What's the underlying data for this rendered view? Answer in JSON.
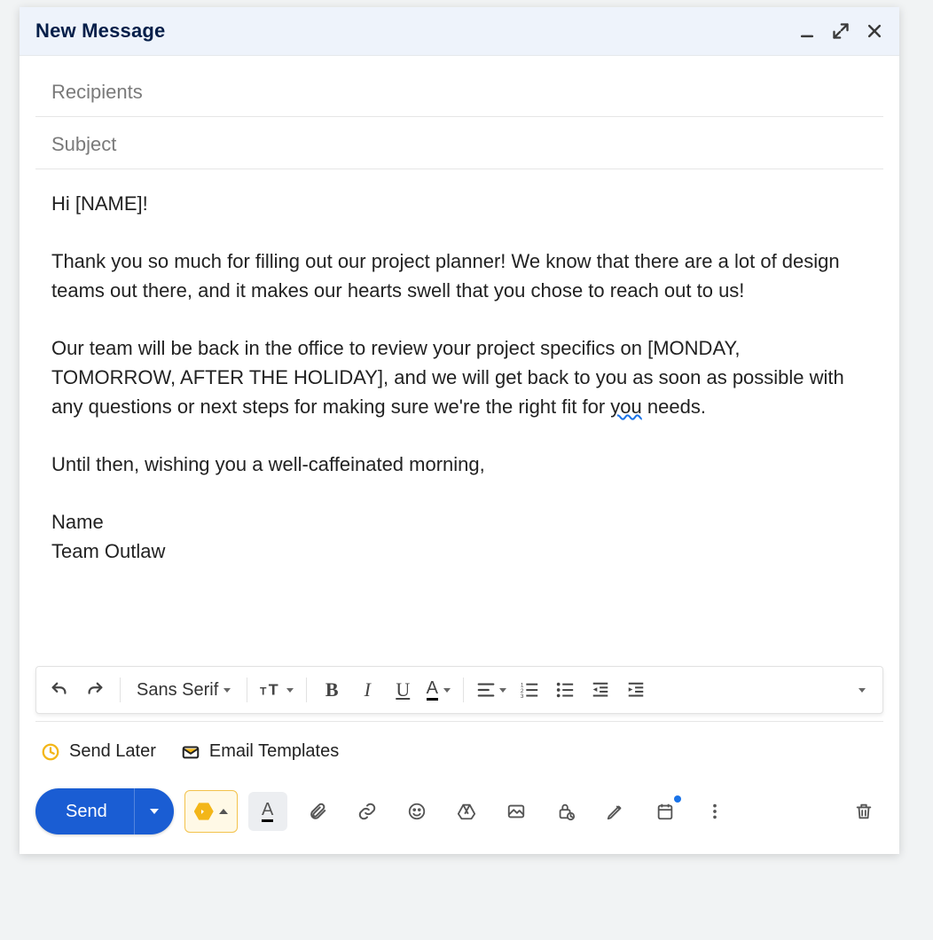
{
  "header": {
    "title": "New Message"
  },
  "fields": {
    "recipients_placeholder": "Recipients",
    "subject_placeholder": "Subject"
  },
  "body": {
    "greeting": "Hi [NAME]!",
    "p1": "Thank you so much for filling out our project planner! We know that there are a lot of design teams out there, and it makes our hearts swell that you chose to reach out to us!",
    "p2a": "Our team will be back in the office to review your project specifics on [MONDAY, TOMORROW, AFTER THE HOLIDAY], and we will get back to you as soon as possible with any questions or next steps for making sure we're the right fit for ",
    "p2_spell": "you",
    "p2b": " needs.",
    "closing": "Until then, wishing you a well-caffeinated morning,",
    "sig_name": "Name",
    "sig_team": "Team Outlaw"
  },
  "formatting": {
    "font_family": "Sans Serif"
  },
  "extensions": {
    "send_later": "Send Later",
    "email_templates": "Email Templates"
  },
  "actions": {
    "send_label": "Send"
  },
  "icons": {
    "minimize": "minimize-icon",
    "expand": "expand-icon",
    "close": "close-icon",
    "undo": "undo-icon",
    "redo": "redo-icon",
    "font_size": "font-size-icon",
    "bold": "bold-icon",
    "italic": "italic-icon",
    "underline": "underline-icon",
    "text_color": "text-color-icon",
    "align": "align-icon",
    "numbered_list": "numbered-list-icon",
    "bulleted_list": "bulleted-list-icon",
    "indent_less": "indent-decrease-icon",
    "indent_more": "indent-increase-icon",
    "more_formatting": "more-formatting-icon",
    "clock": "clock-icon",
    "template": "mail-template-icon",
    "formatting_toggle": "text-format-icon",
    "attach": "paperclip-icon",
    "link": "link-icon",
    "emoji": "emoji-icon",
    "drive": "drive-icon",
    "image": "image-icon",
    "confidential": "lock-clock-icon",
    "signature": "pen-icon",
    "schedule": "calendar-icon",
    "more": "more-vert-icon",
    "discard": "trash-icon",
    "plugin": "plugin-hexagon-icon"
  },
  "colors": {
    "accent_blue": "#1a5dd3",
    "plugin_yellow": "#f3b618"
  }
}
